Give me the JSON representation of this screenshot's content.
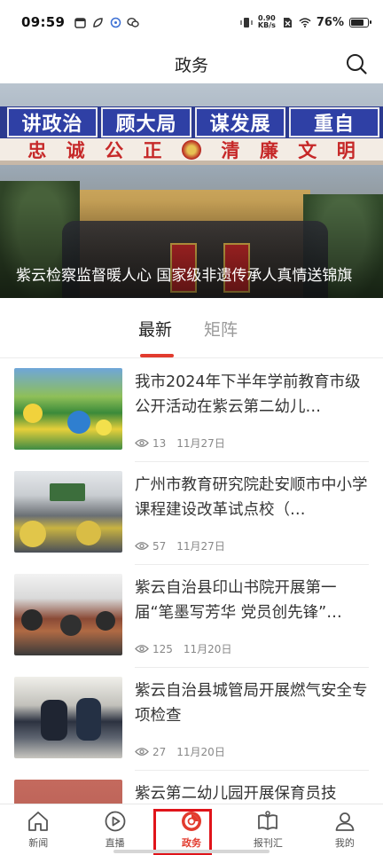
{
  "status_bar": {
    "time": "09:59",
    "net_speed_value": "0.90",
    "net_speed_unit": "KB/s",
    "battery_percent": "76%",
    "battery_level": 0.76
  },
  "header": {
    "title": "政务"
  },
  "hero": {
    "caption": "紫云检察监督暖人心  国家级非遗传承人真情送锦旗",
    "banner_blue": [
      "讲政治",
      "顾大局",
      "谋发展",
      "重自"
    ],
    "banner_red": [
      "忠",
      "诚",
      "公",
      "正",
      "清",
      "廉",
      "文",
      "明"
    ]
  },
  "tabs": [
    {
      "label": "最新",
      "active": true
    },
    {
      "label": "矩阵",
      "active": false
    }
  ],
  "news": [
    {
      "title": "我市2024年下半年学前教育市级公开活动在紫云第二幼儿…",
      "views": "13",
      "date": "11月27日"
    },
    {
      "title": "广州市教育研究院赴安顺市中小学课程建设改革试点校（…",
      "views": "57",
      "date": "11月27日"
    },
    {
      "title": "紫云自治县印山书院开展第一届“笔墨写芳华 党员创先锋”…",
      "views": "125",
      "date": "11月20日"
    },
    {
      "title": "紫云自治县城管局开展燃气安全专项检查",
      "views": "27",
      "date": "11月20日"
    },
    {
      "title": "紫云第二幼儿园开展保育员技",
      "views": "",
      "date": ""
    }
  ],
  "bottom_nav": [
    {
      "label": "新闻",
      "icon": "home-icon",
      "active": false
    },
    {
      "label": "直播",
      "icon": "play-icon",
      "active": false
    },
    {
      "label": "政务",
      "icon": "gov-icon",
      "active": true
    },
    {
      "label": "报刊汇",
      "icon": "book-icon",
      "active": false
    },
    {
      "label": "我的",
      "icon": "user-icon",
      "active": false
    }
  ],
  "colors": {
    "accent": "#e23b2e",
    "highlight_box": "#e0141a",
    "text_primary": "#333333",
    "text_meta": "#888888"
  }
}
